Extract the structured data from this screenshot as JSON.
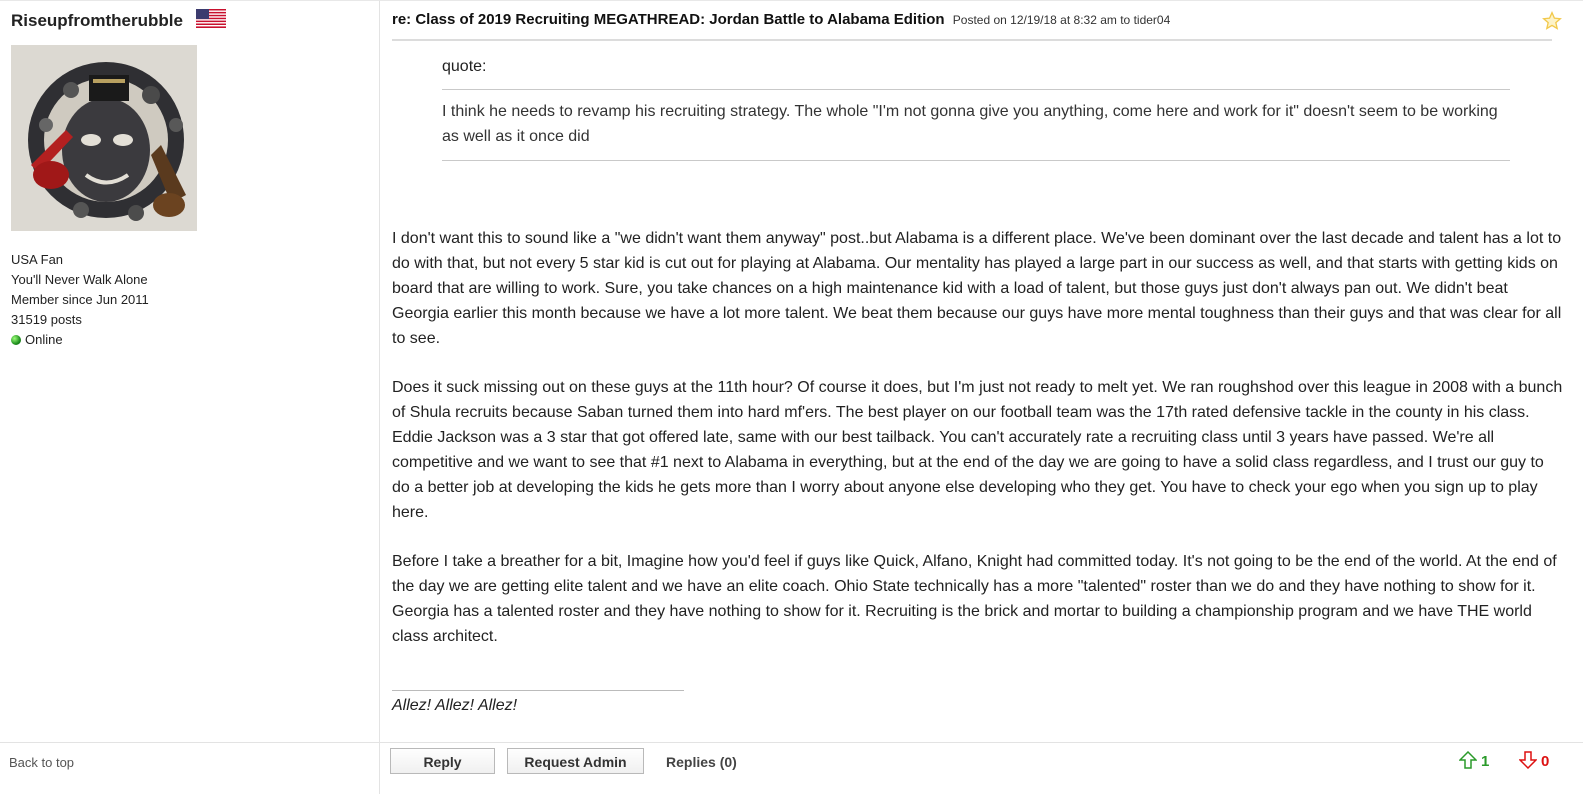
{
  "user": {
    "name": "Riseupfromtherubble",
    "fan_of": "USA Fan",
    "motto": "You'll Never Walk Alone",
    "member_since": "Member since Jun 2011",
    "posts": "31519 posts",
    "status": "Online",
    "flag_icon": "us-flag-icon"
  },
  "post": {
    "title": "re: Class of 2019 Recruiting MEGATHREAD: Jordan Battle to Alabama Edition",
    "meta": "Posted on 12/19/18 at 8:32 am to tider04",
    "quote_label": "quote:",
    "quote_text": "I think he needs to revamp his recruiting strategy. The whole \"I'm not gonna give you anything, come here and work for it\" doesn't seem to be working as well as it once did",
    "paragraphs": [
      "I don't want this to sound like a \"we didn't want them anyway\" post..but Alabama is a different place. We've been dominant over the last decade and talent has a lot to do with that, but not every 5 star kid is cut out for playing at Alabama. Our mentality has played a large part in our success as well, and that starts with getting kids on board that are willing to work. Sure, you take chances on a high maintenance kid with a load of talent, but those guys just don't always pan out. We didn't beat Georgia earlier this month because we have a lot more talent. We beat them because our guys have more mental toughness than their guys and that was clear for all to see.",
      "Does it suck missing out on these guys at the 11th hour? Of course it does, but I'm just not ready to melt yet. We ran roughshod over this league in 2008 with a bunch of Shula recruits because Saban turned them into hard mf'ers. The best player on our football team was the 17th rated defensive tackle in the county in his class. Eddie Jackson was a 3 star that got offered late, same with our best tailback. You can't accurately rate a recruiting class until 3 years have passed. We're all competitive and we want to see that #1 next to Alabama in everything, but at the end of the day we are going to have a solid class regardless, and I trust our guy to do a better job at developing the kids he gets more than I worry about anyone else developing who they get. You have to check your ego when you sign up to play here.",
      "Before I take a breather for a bit, Imagine how you'd feel if guys like Quick, Alfano, Knight had committed today. It's not going to be the end of the world. At the end of the day we are getting elite talent and we have an elite coach. Ohio State technically has a more \"talented\" roster than we do and they have nothing to show for it. Georgia has a talented roster and they have nothing to show for it. Recruiting is the brick and mortar to building a championship program and we have THE world class architect."
    ],
    "signature": "Allez! Allez! Allez!"
  },
  "footer": {
    "back_to_top": "Back to top",
    "reply_label": "Reply",
    "request_admin_label": "Request Admin",
    "replies_label": "Replies (0)",
    "upvotes": "1",
    "downvotes": "0"
  },
  "colors": {
    "upvote": "#2a9a2a",
    "downvote": "#dd1111",
    "star": "#f2c94c"
  }
}
